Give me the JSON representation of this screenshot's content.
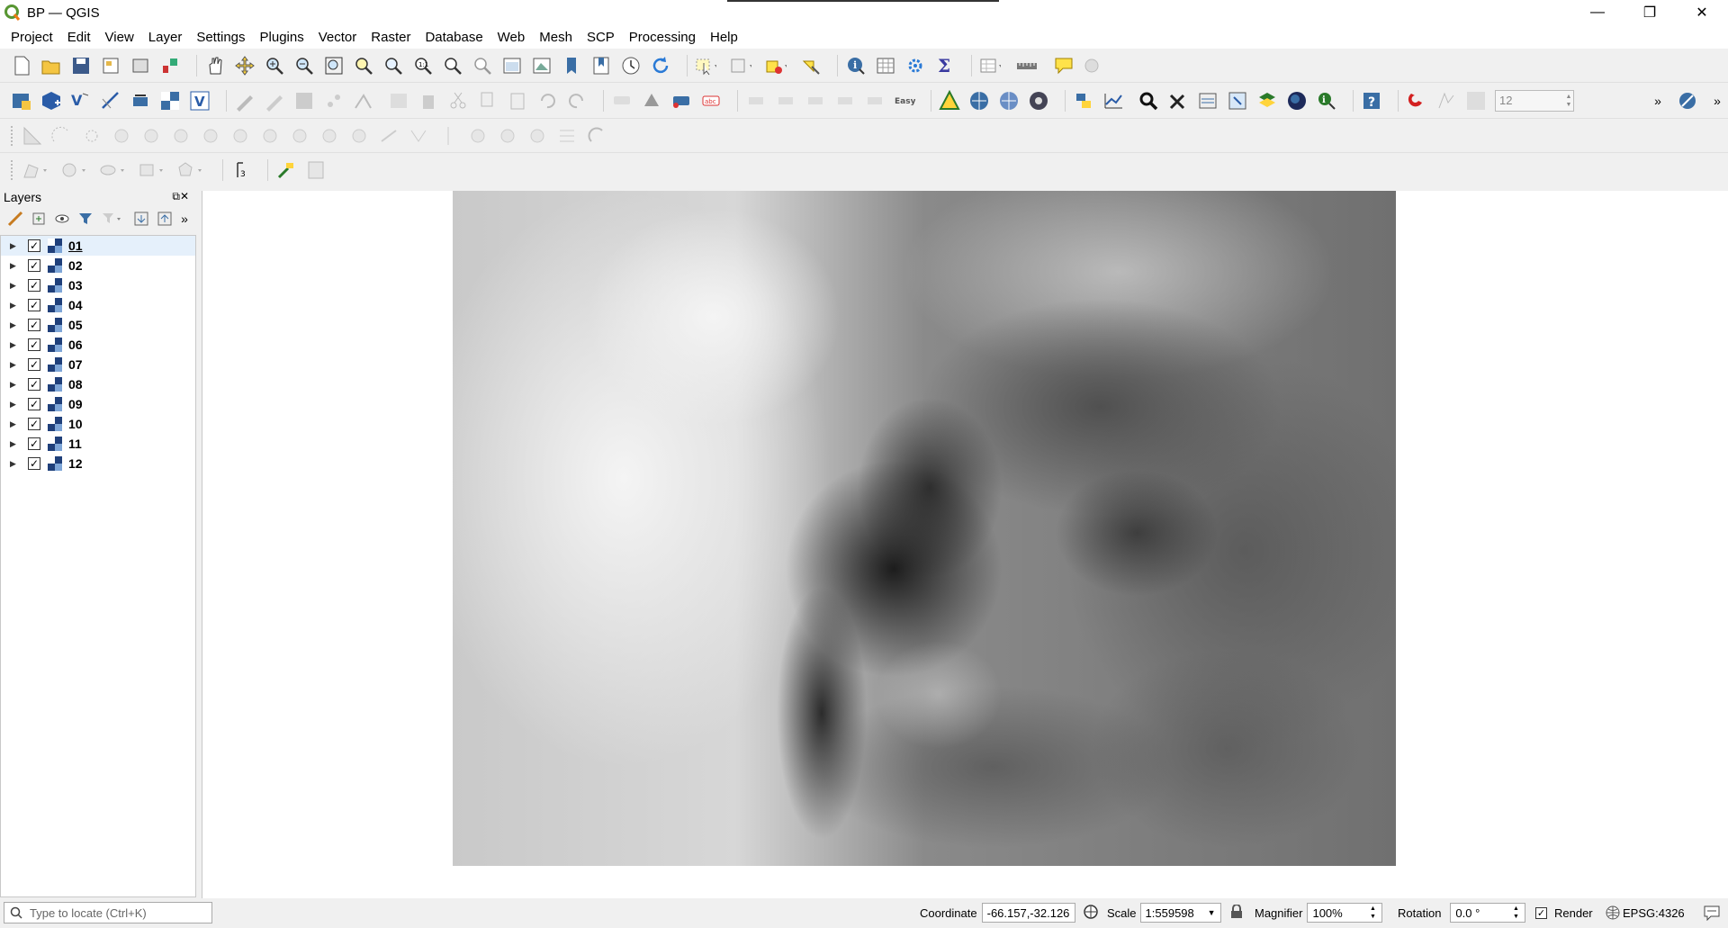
{
  "window": {
    "title": "BP — QGIS"
  },
  "menu": [
    {
      "label": "Project"
    },
    {
      "label": "Edit"
    },
    {
      "label": "View"
    },
    {
      "label": "Layer"
    },
    {
      "label": "Settings"
    },
    {
      "label": "Plugins"
    },
    {
      "label": "Vector"
    },
    {
      "label": "Raster"
    },
    {
      "label": "Database"
    },
    {
      "label": "Web"
    },
    {
      "label": "Mesh"
    },
    {
      "label": "SCP"
    },
    {
      "label": "Processing"
    },
    {
      "label": "Help"
    }
  ],
  "toolbar": {
    "snap_tolerance": "12"
  },
  "layers_panel": {
    "title": "Layers",
    "layers": [
      {
        "name": "01",
        "checked": true,
        "selected": true
      },
      {
        "name": "02",
        "checked": true
      },
      {
        "name": "03",
        "checked": true
      },
      {
        "name": "04",
        "checked": true
      },
      {
        "name": "05",
        "checked": true
      },
      {
        "name": "06",
        "checked": true
      },
      {
        "name": "07",
        "checked": true
      },
      {
        "name": "08",
        "checked": true
      },
      {
        "name": "09",
        "checked": true
      },
      {
        "name": "10",
        "checked": true
      },
      {
        "name": "11",
        "checked": true
      },
      {
        "name": "12",
        "checked": true
      }
    ]
  },
  "status": {
    "locate_placeholder": "Type to locate (Ctrl+K)",
    "coordinate_label": "Coordinate",
    "coordinate_value": "-66.157,-32.126",
    "scale_label": "Scale",
    "scale_value": "1:559598",
    "magnifier_label": "Magnifier",
    "magnifier_value": "100%",
    "rotation_label": "Rotation",
    "rotation_value": "0.0 °",
    "render_label": "Render",
    "crs": "EPSG:4326"
  }
}
